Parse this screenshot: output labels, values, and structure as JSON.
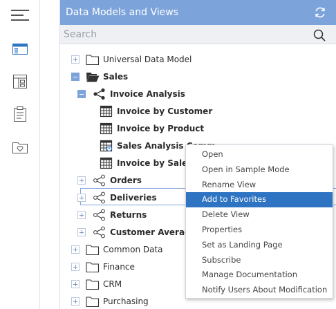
{
  "rail": {
    "items": [
      {
        "name": "menu-icon"
      },
      {
        "name": "data-models-icon"
      },
      {
        "name": "dashboard-icon"
      },
      {
        "name": "clipboard-icon"
      },
      {
        "name": "favorites-folder-icon"
      }
    ]
  },
  "header": {
    "title": "Data Models and Views"
  },
  "search": {
    "placeholder": "Search"
  },
  "tree": {
    "universal": "Universal Data Model",
    "sales": "Sales",
    "invoice_analysis": "Invoice Analysis",
    "invoice_by_customer": "Invoice by Customer",
    "invoice_by_product": "Invoice by Product",
    "sales_analysis_comm": "Sales Analysis Comm",
    "invoice_by_sales_rep": "Invoice by Sales Re",
    "orders": "Orders",
    "deliveries": "Deliveries",
    "returns": "Returns",
    "customer_average": "Customer Average P",
    "common_data": "Common Data",
    "finance": "Finance",
    "crm": "CRM",
    "purchasing": "Purchasing"
  },
  "context_menu": {
    "items": [
      "Open",
      "Open in Sample Mode",
      "Rename View",
      "Add to Favorites",
      "Delete View",
      "Properties",
      "Set as Landing Page",
      "Subscribe",
      "Manage Documentation",
      "Notify Users About Modification"
    ],
    "active": "Add to Favorites"
  },
  "colors": {
    "accent": "#7da3db",
    "menu_active": "#2f74c2"
  }
}
